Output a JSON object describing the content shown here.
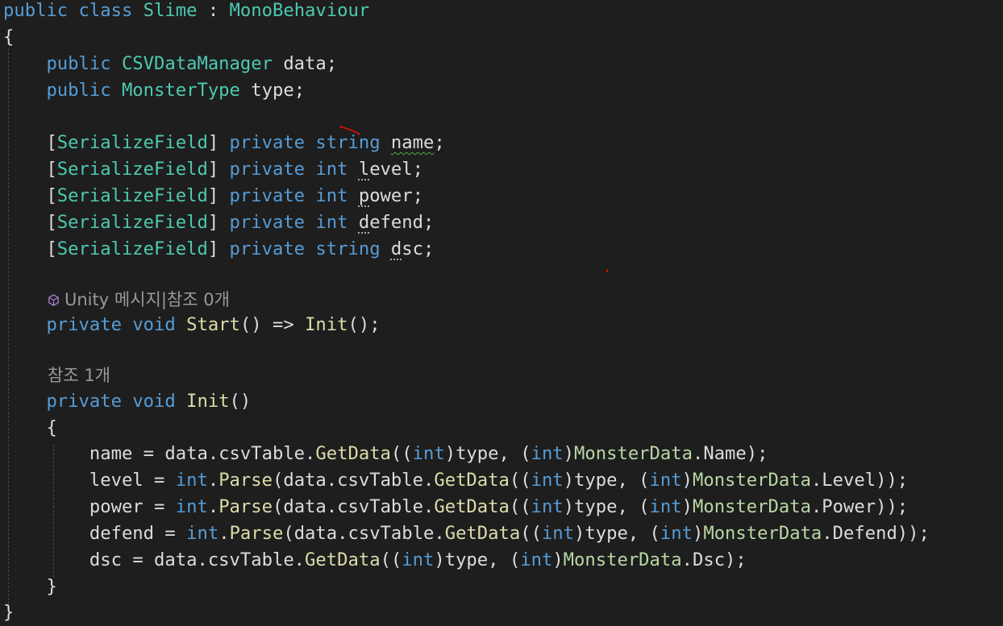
{
  "colors": {
    "background": "#1e1e1e",
    "keyword": "#569cd6",
    "type": "#4ec9b0",
    "method": "#dcdcaa",
    "enum_member": "#b8d7a3",
    "plain": "#dcdcdc",
    "codelens": "#999999",
    "squiggle": "#4ea84a",
    "pen_mark": "#e51400"
  },
  "icons": {
    "unity": "unity-cube-icon"
  },
  "code": {
    "class_decl": {
      "public": "public",
      "class": "class",
      "name": "Slime",
      "colon": ":",
      "base": "MonoBehaviour"
    },
    "open_brace": "{",
    "close_brace": "}",
    "field_data": {
      "modifier": "public",
      "type": "CSVDataManager",
      "rest": "data;"
    },
    "field_type": {
      "modifier": "public",
      "type": "MonsterType",
      "rest": "type;"
    },
    "serialized_fields": [
      {
        "attr": "SerializeField",
        "modifier": "private",
        "type": "string",
        "name": "name"
      },
      {
        "attr": "SerializeField",
        "modifier": "private",
        "type": "int",
        "name": "level"
      },
      {
        "attr": "SerializeField",
        "modifier": "private",
        "type": "int",
        "name": "power"
      },
      {
        "attr": "SerializeField",
        "modifier": "private",
        "type": "int",
        "name": "defend"
      },
      {
        "attr": "SerializeField",
        "modifier": "private",
        "type": "string",
        "name": "dsc"
      }
    ],
    "codelens_start": {
      "unity": "Unity 메시지",
      "separator": "|",
      "refs": "참조 0개"
    },
    "start_method": {
      "private": "private",
      "void": "void",
      "name": "Start",
      "arrow": "() =>",
      "call": "Init",
      "end": "();"
    },
    "codelens_init": "참조 1개",
    "init_method": {
      "private": "private",
      "void": "void",
      "name": "Init",
      "parens": "()"
    },
    "init_open": "{",
    "init_close": "}",
    "body": {
      "name_line": {
        "lhs": "name = data.csvTable.",
        "method": "GetData",
        "arg_open": "((",
        "int1": "int",
        "mid": ")type, (",
        "int2": "int",
        "close_cast": ")",
        "enum_type": "MonsterData",
        "member": ".Name);"
      },
      "level_line": {
        "lhs": "level = ",
        "int_type": "int",
        "dot": ".",
        "parse": "Parse",
        "pre": "(data.csvTable.",
        "method": "GetData",
        "arg_open": "((",
        "int1": "int",
        "mid": ")type, (",
        "int2": "int",
        "close_cast": ")",
        "enum_type": "MonsterData",
        "member": ".Level));"
      },
      "power_line": {
        "lhs": "power = ",
        "int_type": "int",
        "dot": ".",
        "parse": "Parse",
        "pre": "(data.csvTable.",
        "method": "GetData",
        "arg_open": "((",
        "int1": "int",
        "mid": ")type, (",
        "int2": "int",
        "close_cast": ")",
        "enum_type": "MonsterData",
        "member": ".Power));"
      },
      "defend_line": {
        "lhs": "defend = ",
        "int_type": "int",
        "dot": ".",
        "parse": "Parse",
        "pre": "(data.csvTable.",
        "method": "GetData",
        "arg_open": "((",
        "int1": "int",
        "mid": ")type, (",
        "int2": "int",
        "close_cast": ")",
        "enum_type": "MonsterData",
        "member": ".Defend));"
      },
      "dsc_line": {
        "lhs": "dsc = data.csvTable.",
        "method": "GetData",
        "arg_open": "((",
        "int1": "int",
        "mid": ")type, (",
        "int2": "int",
        "close_cast": ")",
        "enum_type": "MonsterData",
        "member": ".Dsc);"
      }
    }
  }
}
